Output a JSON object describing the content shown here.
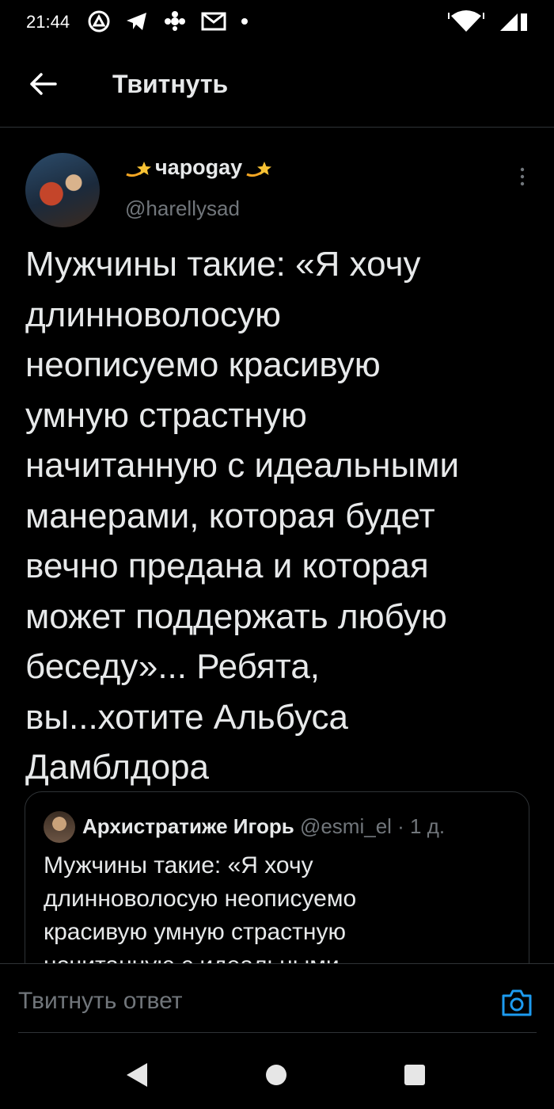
{
  "status_bar": {
    "time": "21:44"
  },
  "header": {
    "title": "Твитнуть"
  },
  "tweet": {
    "author_name": "чароgау",
    "handle": "@harellysad",
    "text": "Мужчины такие: «Я хочу\nдлинноволосую\nнеописуемо красивую\nумную страстную\nначитанную с идеальными\nманерами, которая будет\nвечно предана и которая\nможет поддержать любую\nбеседу»... Ребята,\nвы...хотите Альбуса\nДамблдора"
  },
  "quoted_tweet": {
    "author_name": "Архистратиже Игорь",
    "handle_time": "@esmi_el · 1 д.",
    "text": "Мужчины такие: «Я хочу\nдлинноволосую неописуемо\nкрасивую умную страстную\nначитанную с идеальными"
  },
  "reply": {
    "placeholder": "Твитнуть ответ"
  },
  "colors": {
    "background": "#000000",
    "text_primary": "#e7e9ea",
    "text_secondary": "#71767b",
    "accent": "#1d9bf0",
    "divider": "#2f3336"
  },
  "icons": {
    "back": "arrow-left-icon",
    "more": "more-vertical-icon",
    "camera": "camera-icon",
    "author_name_decoration": "shooting-star-icon"
  }
}
